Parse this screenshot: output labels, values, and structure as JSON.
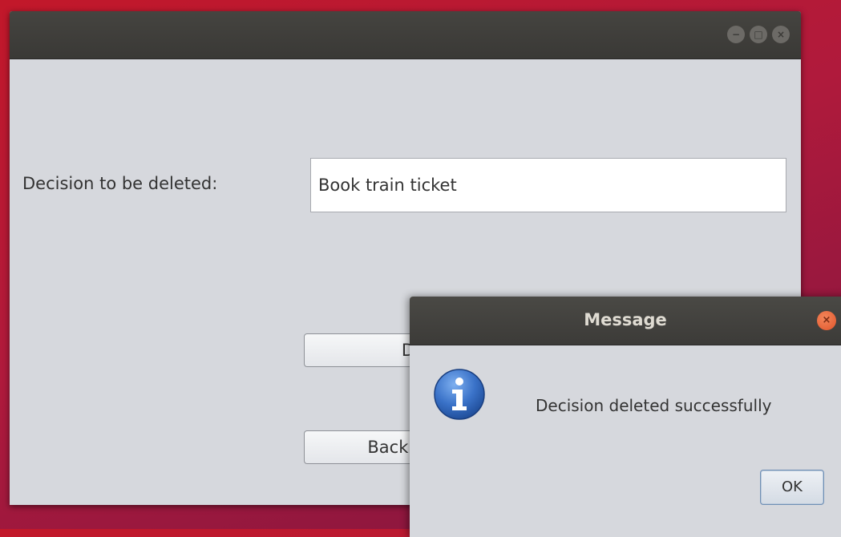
{
  "main_window": {
    "title": "",
    "controls": {
      "minimize": "minimize-icon",
      "maximize": "maximize-icon",
      "close": "close-icon"
    },
    "form": {
      "decision_label": "Decision to be deleted:",
      "decision_value": "Book train ticket",
      "delete_button_label": "D",
      "back_button_label": "Back to H"
    }
  },
  "dialog": {
    "title": "Message",
    "icon": "info-icon",
    "message": "Decision deleted successfully",
    "ok_label": "OK",
    "close_icon": "close-icon"
  },
  "colors": {
    "desktop": "#b01a3c",
    "titlebar": "#3c3b38",
    "window_bg": "#d6d8dd",
    "dialog_close": "#e0552b",
    "info_blue": "#2d62b8"
  }
}
